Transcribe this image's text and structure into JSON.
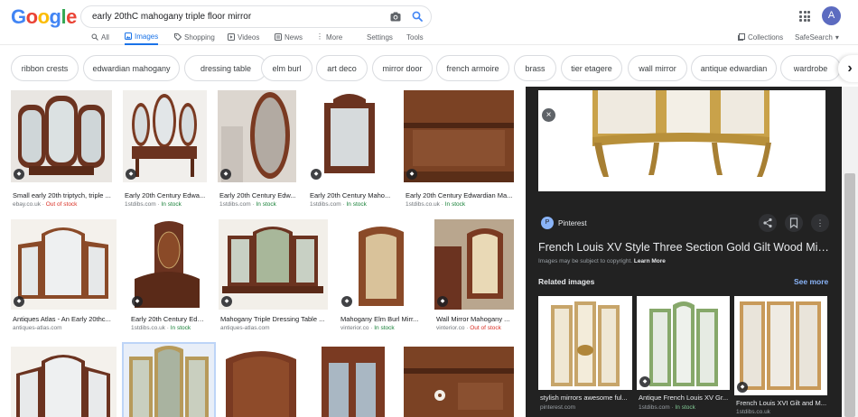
{
  "header": {
    "logo": [
      "G",
      "o",
      "o",
      "g",
      "l",
      "e"
    ],
    "logo_colors": [
      "#4285F4",
      "#EA4335",
      "#FBBC05",
      "#4285F4",
      "#34A853",
      "#EA4335"
    ],
    "search_value": "early 20thC mahogany  triple floor mirror",
    "avatar_letter": "A"
  },
  "tabs": [
    {
      "label": "All",
      "icon": "search-icon"
    },
    {
      "label": "Images",
      "icon": "image-icon",
      "active": true
    },
    {
      "label": "Shopping",
      "icon": "tag-icon"
    },
    {
      "label": "Videos",
      "icon": "play-icon"
    },
    {
      "label": "News",
      "icon": "news-icon"
    },
    {
      "label": "More",
      "icon": "more-vertical-icon"
    },
    {
      "label": "Settings"
    },
    {
      "label": "Tools"
    }
  ],
  "tabs_right": {
    "collections": "Collections",
    "safesearch": "SafeSearch"
  },
  "chips": [
    "ribbon crests",
    "edwardian mahogany",
    "dressing table",
    "elm burl",
    "art deco",
    "mirror door",
    "french armoire",
    "brass",
    "tier etagere",
    "wall mirror",
    "antique edwardian",
    "wardrobe"
  ],
  "results": [
    {
      "title": "Small early 20th triptych, triple ...",
      "source": "ebay.co.uk",
      "stock": "Out of stock",
      "stock_type": "out"
    },
    {
      "title": "Early 20th Century Edwa...",
      "source": "1stdibs.com",
      "stock": "In stock",
      "stock_type": "in"
    },
    {
      "title": "Early 20th Century Edw...",
      "source": "1stdibs.com",
      "stock": "In stock",
      "stock_type": "in"
    },
    {
      "title": "Early 20th Century Maho...",
      "source": "1stdibs.com",
      "stock": "In stock",
      "stock_type": "in"
    },
    {
      "title": "Early 20th Century Edwardian Ma...",
      "source": "1stdibs.co.uk",
      "stock": "In stock",
      "stock_type": "in"
    },
    {
      "title": "Antiques Atlas - An Early 20thc...",
      "source": "antiques-atlas.com",
      "stock": "",
      "stock_type": ""
    },
    {
      "title": "Early 20th Century Edw...",
      "source": "1stdibs.co.uk",
      "stock": "In stock",
      "stock_type": "in"
    },
    {
      "title": "Mahogany Triple Dressing Table ...",
      "source": "antiques-atlas.com",
      "stock": "",
      "stock_type": ""
    },
    {
      "title": "Mahogany Elm Burl Mirr...",
      "source": "vinterior.co",
      "stock": "In stock",
      "stock_type": "in"
    },
    {
      "title": "Wall Mirror Mahogany ...",
      "source": "vinterior.co",
      "stock": "Out of stock",
      "stock_type": "out"
    },
    {
      "title": "",
      "source": "",
      "stock": "",
      "stock_type": ""
    },
    {
      "title": "",
      "source": "",
      "stock": "",
      "stock_type": ""
    },
    {
      "title": "",
      "source": "",
      "stock": "",
      "stock_type": ""
    },
    {
      "title": "",
      "source": "",
      "stock": "",
      "stock_type": ""
    },
    {
      "title": "",
      "source": "",
      "stock": "",
      "stock_type": ""
    }
  ],
  "panel": {
    "source_name": "Pinterest",
    "source_letter": "P",
    "title": "French Louis XV Style Three Section Gold Gilt Wood Mirro...",
    "note_prefix": "Images may be subject to copyright. ",
    "note_link": "Learn More",
    "related_label": "Related images",
    "see_more": "See more",
    "related": [
      {
        "title": "stylish mirrors awesome ful...",
        "source": "pinterest.com",
        "stock": ""
      },
      {
        "title": "Antique French Louis XV Gr...",
        "source": "1stdibs.com",
        "stock": "In stock"
      },
      {
        "title": "French Louis XVI Gilt and M...",
        "source": "1stdibs.co.uk",
        "stock": ""
      }
    ]
  },
  "colors": {
    "accent": "#1a73e8",
    "in_stock": "#188038",
    "out_of_stock": "#d93025",
    "wood": "#6b3320",
    "panel_bg": "#222222"
  }
}
